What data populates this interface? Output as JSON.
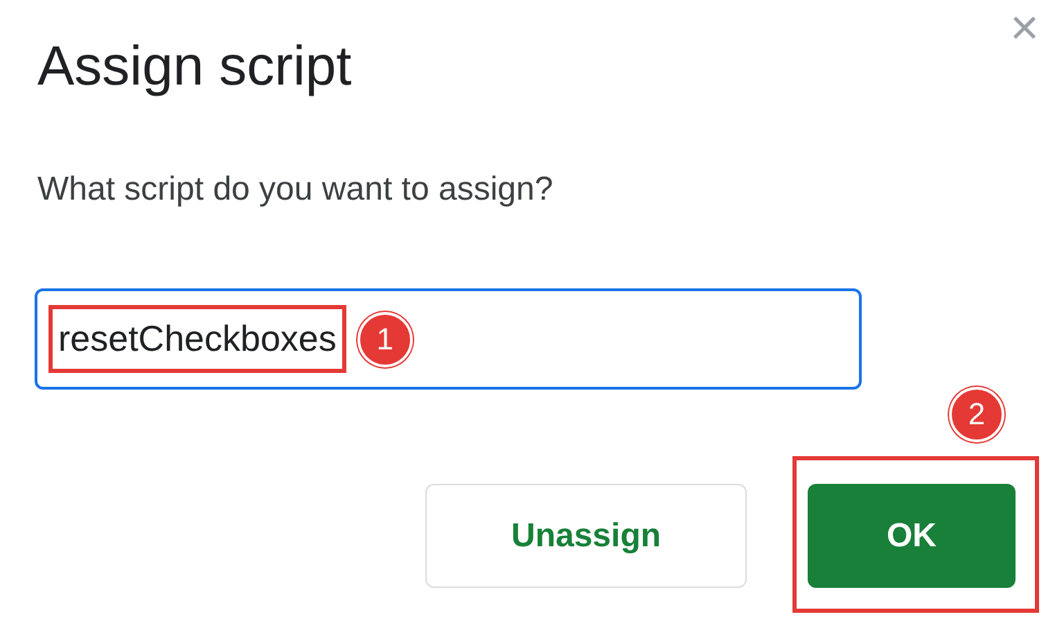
{
  "dialog": {
    "title": "Assign script",
    "close": "×",
    "question": "What script do you want to assign?"
  },
  "script_field": {
    "value": "resetCheckboxes",
    "focused": true,
    "highlighted": true,
    "callout": "1"
  },
  "buttons": [
    {
      "label": "Unassign",
      "kind": "secondary",
      "highlighted": false
    },
    {
      "label": "OK",
      "kind": "primary",
      "highlighted": true,
      "callout": "2"
    }
  ]
}
